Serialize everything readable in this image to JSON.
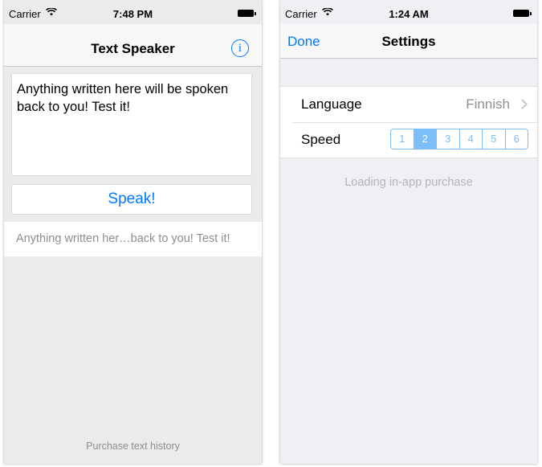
{
  "left": {
    "status": {
      "carrier": "Carrier",
      "time": "7:48 PM"
    },
    "title": "Text Speaker",
    "info_icon": "i",
    "text_content": "Anything written here will be spoken back to you! Test it!",
    "speak_label": "Speak!",
    "history_item": "Anything written her…back to you! Test it!",
    "purchase_label": "Purchase text history"
  },
  "right": {
    "status": {
      "carrier": "Carrier",
      "time": "1:24 AM"
    },
    "title": "Settings",
    "done_label": "Done",
    "language_label": "Language",
    "language_value": "Finnish",
    "speed_label": "Speed",
    "speed_options": [
      "1",
      "2",
      "3",
      "4",
      "5",
      "6"
    ],
    "speed_selected": "2",
    "loading_text": "Loading in-app purchase"
  },
  "colors": {
    "accent": "#007aff",
    "segment": "#7cbef8"
  }
}
